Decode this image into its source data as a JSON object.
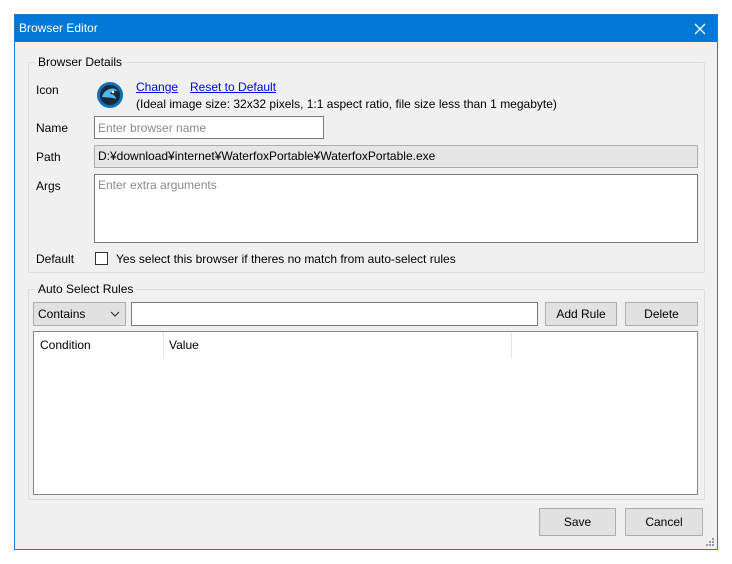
{
  "window": {
    "title": "Browser Editor"
  },
  "browser_details": {
    "group_label": "Browser Details",
    "icon_label": "Icon",
    "change_link": "Change",
    "reset_link": "Reset to Default",
    "icon_hint": "(Ideal image size: 32x32 pixels, 1:1 aspect ratio, file size less than 1 megabyte)",
    "name_label": "Name",
    "name_placeholder": "Enter browser name",
    "name_value": "",
    "path_label": "Path",
    "path_value": "D:¥download¥internet¥WaterfoxPortable¥WaterfoxPortable.exe",
    "args_label": "Args",
    "args_placeholder": "Enter extra arguments",
    "default_label": "Default",
    "default_checkbox_text": "Yes select this browser if theres no match from auto-select rules",
    "default_checked": false
  },
  "auto_select_rules": {
    "group_label": "Auto Select Rules",
    "match_selected": "Contains",
    "rule_value": "",
    "add_rule_label": "Add Rule",
    "delete_label": "Delete",
    "columns": [
      "Condition",
      "Value"
    ],
    "rows": []
  },
  "footer": {
    "save_label": "Save",
    "cancel_label": "Cancel"
  },
  "colors": {
    "titlebar": "#0078d7",
    "link": "#0000ee",
    "window_bg": "#f0f0f0"
  },
  "icons": {
    "app_icon": "waterfox-icon",
    "close": "close-icon",
    "dropdown": "chevron-down-icon",
    "resize": "resize-grip-icon"
  }
}
